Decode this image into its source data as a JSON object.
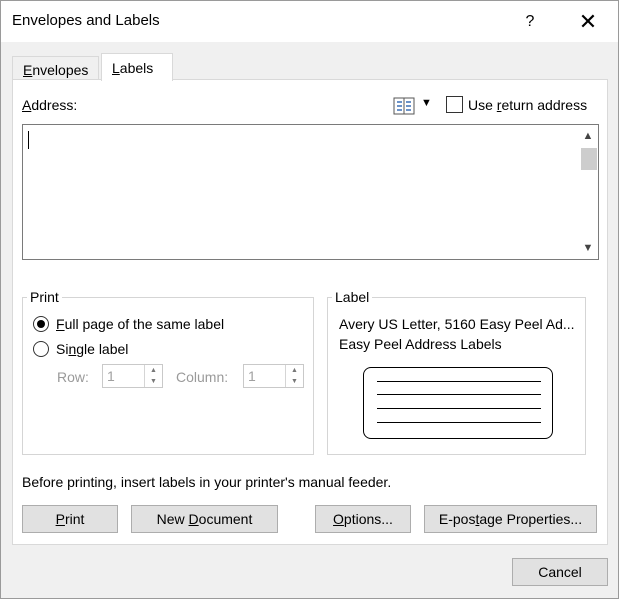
{
  "window": {
    "title": "Envelopes and Labels",
    "help_label": "?",
    "close_label": "✕"
  },
  "tabs": [
    {
      "label": "Envelopes",
      "underline": "E",
      "rest": "nvelopes",
      "active": false
    },
    {
      "label": "Labels",
      "underline": "L",
      "rest": "abels",
      "active": true
    }
  ],
  "address": {
    "label_u": "A",
    "label_rest": "ddress:",
    "value": "",
    "address_book_icon": "address-book-icon",
    "use_return_address": {
      "pre": "Use ",
      "u": "r",
      "post": "eturn address",
      "checked": false
    }
  },
  "print_group": {
    "title": "Print",
    "full_page": {
      "u": "F",
      "rest": "ull page of the same label",
      "checked": true
    },
    "single_label": {
      "pre": "Si",
      "u": "n",
      "post": "gle label",
      "checked": false
    },
    "row_label": "Row:",
    "row_value": "1",
    "column_label": "Column:",
    "column_value": "1"
  },
  "label_group": {
    "title": "Label",
    "line1": "Avery US Letter, 5160 Easy Peel Ad...",
    "line2": "Easy Peel Address Labels"
  },
  "hint": "Before printing, insert labels in your printer's manual feeder.",
  "buttons": {
    "print": {
      "u": "P",
      "rest": "rint"
    },
    "new_document": {
      "pre": "New ",
      "u": "D",
      "post": "ocument"
    },
    "options": {
      "u": "O",
      "rest": "ptions..."
    },
    "epostage": {
      "pre": "E-pos",
      "u": "t",
      "post": "age Properties..."
    },
    "cancel": "Cancel"
  }
}
